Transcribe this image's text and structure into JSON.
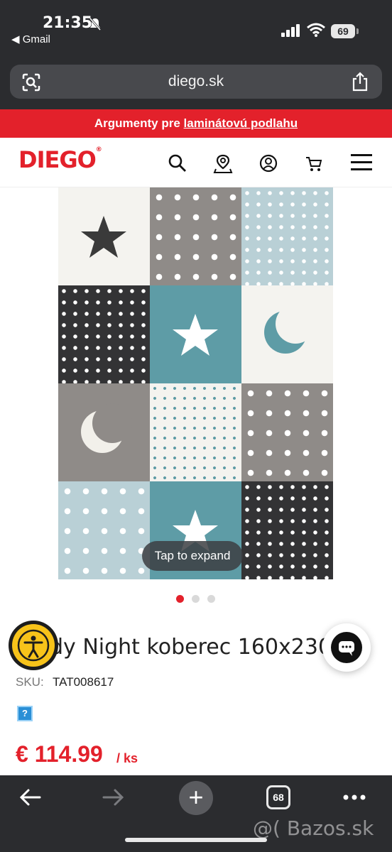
{
  "status_bar": {
    "time": "21:35",
    "back_app": "◀ Gmail",
    "battery": "69"
  },
  "browser": {
    "url": "diego.sk",
    "tabs_count": "68",
    "watermark": "@( Bazos.sk"
  },
  "promo": {
    "text_prefix": "Argumenty pre",
    "link_text": "laminátovú podlahu"
  },
  "header": {
    "logo_text": "DIEGO",
    "logo_mark": "®"
  },
  "gallery": {
    "expand_label": "Tap to expand",
    "page_count": 3,
    "active_page": 1
  },
  "product": {
    "title": "dy Night koberec 160x230",
    "sku_label": "SKU:",
    "sku_value": "TAT008617",
    "help_icon_text": "?",
    "price": "€ 114.99",
    "unit": "/ ks"
  },
  "colors": {
    "brand_red": "#e3212b",
    "rug_teal": "#5c9aa4",
    "rug_grey": "#8f8f8f",
    "rug_dark": "#3a3a3a"
  },
  "icons": [
    "bell-slash-icon",
    "signal-icon",
    "wifi-icon",
    "lens-icon",
    "share-icon",
    "search-icon",
    "store-locator-icon",
    "account-icon",
    "cart-icon",
    "menu-icon",
    "accessibility-icon",
    "chat-icon",
    "back-arrow-icon",
    "forward-arrow-icon",
    "new-tab-icon",
    "more-icon"
  ]
}
